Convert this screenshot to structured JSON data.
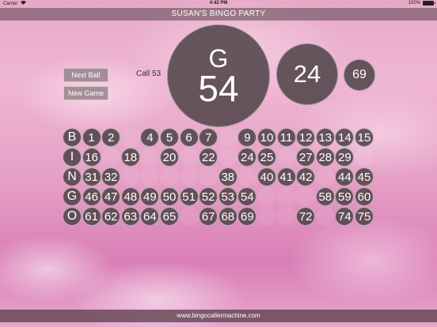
{
  "status_bar": {
    "carrier": "Carrier",
    "time": "4:42 PM",
    "battery": "100%",
    "wifi_icon": "wifi-icon",
    "battery_icon": "battery-icon"
  },
  "title": "SUSAN'S BINGO PARTY",
  "buttons": {
    "next_ball": "Next Ball",
    "new_game": "New Game"
  },
  "call_label": "Call 53",
  "current_ball": {
    "letter": "G",
    "number": "54"
  },
  "previous_balls": [
    "24",
    "69"
  ],
  "board": [
    {
      "letter": "B",
      "start": 1,
      "called": [
        1,
        2,
        4,
        5,
        6,
        7,
        9,
        10,
        11,
        12,
        13,
        14,
        15
      ]
    },
    {
      "letter": "I",
      "start": 16,
      "called": [
        16,
        18,
        20,
        22,
        24,
        25,
        27,
        28,
        29
      ]
    },
    {
      "letter": "N",
      "start": 31,
      "called": [
        31,
        32,
        38,
        40,
        41,
        42,
        44,
        45
      ]
    },
    {
      "letter": "G",
      "start": 46,
      "called": [
        46,
        47,
        48,
        49,
        50,
        51,
        52,
        53,
        54,
        58,
        59,
        60
      ]
    },
    {
      "letter": "O",
      "start": 61,
      "called": [
        61,
        62,
        63,
        64,
        65,
        67,
        68,
        69,
        72,
        74,
        75
      ]
    }
  ],
  "footer": "www.bingocallermachine.com",
  "colors": {
    "ball": "#52464a",
    "titlebar": "#6e555f"
  }
}
